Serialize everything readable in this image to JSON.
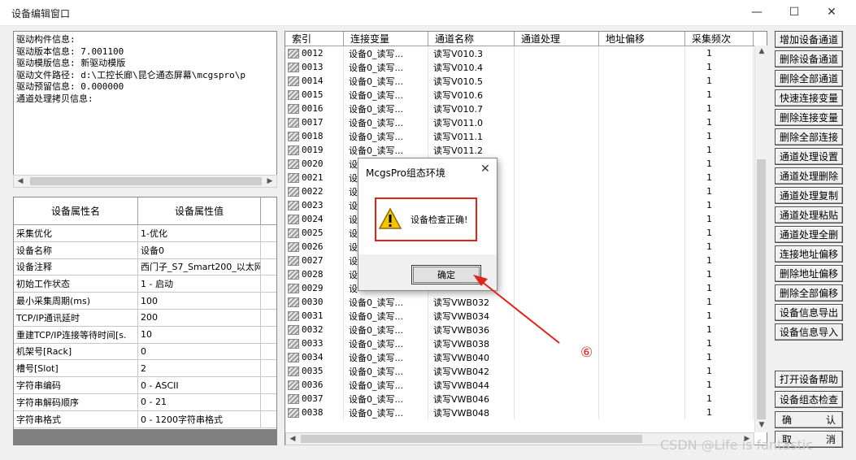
{
  "window": {
    "title": "设备编辑窗口",
    "min_glyph": "—",
    "max_glyph": "☐",
    "close_glyph": "✕"
  },
  "info_lines": [
    "驱动构件信息:",
    "驱动版本信息: 7.001100",
    "驱动模版信息: 新驱动模版",
    "驱动文件路径: d:\\工控长廊\\昆仑通态屏幕\\mcgspro\\p",
    "驱动预留信息: 0.000000",
    "通道处理拷贝信息:"
  ],
  "properties": {
    "header_name": "设备属性名",
    "header_value": "设备属性值",
    "rows": [
      {
        "name": "采集优化",
        "value": "1-优化"
      },
      {
        "name": "设备名称",
        "value": "设备0"
      },
      {
        "name": "设备注释",
        "value": "西门子_S7_Smart200_以太网"
      },
      {
        "name": "初始工作状态",
        "value": "1 - 启动"
      },
      {
        "name": "最小采集周期(ms)",
        "value": "100"
      },
      {
        "name": "TCP/IP通讯延时",
        "value": "200"
      },
      {
        "name": "重建TCP/IP连接等待时间[s.",
        "value": "10"
      },
      {
        "name": "机架号[Rack]",
        "value": "0"
      },
      {
        "name": "槽号[Slot]",
        "value": "2"
      },
      {
        "name": "字符串编码",
        "value": "0 - ASCII"
      },
      {
        "name": "字符串解码顺序",
        "value": "0 - 21"
      },
      {
        "name": "字符串格式",
        "value": "0 - 1200字符串格式"
      }
    ]
  },
  "channels": {
    "headers": [
      "索引",
      "连接变量",
      "通道名称",
      "通道处理",
      "地址偏移",
      "采集频次"
    ],
    "rows": [
      {
        "index": "0012",
        "var": "设备0_读写...",
        "name": "读写V010.3",
        "freq": "1"
      },
      {
        "index": "0013",
        "var": "设备0_读写...",
        "name": "读写V010.4",
        "freq": "1"
      },
      {
        "index": "0014",
        "var": "设备0_读写...",
        "name": "读写V010.5",
        "freq": "1"
      },
      {
        "index": "0015",
        "var": "设备0_读写...",
        "name": "读写V010.6",
        "freq": "1"
      },
      {
        "index": "0016",
        "var": "设备0_读写...",
        "name": "读写V010.7",
        "freq": "1"
      },
      {
        "index": "0017",
        "var": "设备0_读写...",
        "name": "读写V011.0",
        "freq": "1"
      },
      {
        "index": "0018",
        "var": "设备0_读写...",
        "name": "读写V011.1",
        "freq": "1"
      },
      {
        "index": "0019",
        "var": "设备0_读写...",
        "name": "读写V011.2",
        "freq": "1"
      },
      {
        "index": "0020",
        "var": "设",
        "name": "",
        "freq": "1"
      },
      {
        "index": "0021",
        "var": "设",
        "name": "",
        "freq": "1"
      },
      {
        "index": "0022",
        "var": "设",
        "name": "",
        "freq": "1"
      },
      {
        "index": "0023",
        "var": "设",
        "name": "",
        "freq": "1"
      },
      {
        "index": "0024",
        "var": "设",
        "name": "",
        "freq": "1"
      },
      {
        "index": "0025",
        "var": "设",
        "name": "",
        "freq": "1"
      },
      {
        "index": "0026",
        "var": "设",
        "name": "",
        "freq": "1"
      },
      {
        "index": "0027",
        "var": "设",
        "name": "",
        "freq": "1"
      },
      {
        "index": "0028",
        "var": "设",
        "name": "",
        "freq": "1"
      },
      {
        "index": "0029",
        "var": "设",
        "name": "",
        "freq": "1"
      },
      {
        "index": "0030",
        "var": "设备0_读写...",
        "name": "读写VWB032",
        "freq": "1"
      },
      {
        "index": "0031",
        "var": "设备0_读写...",
        "name": "读写VWB034",
        "freq": "1"
      },
      {
        "index": "0032",
        "var": "设备0_读写...",
        "name": "读写VWB036",
        "freq": "1"
      },
      {
        "index": "0033",
        "var": "设备0_读写...",
        "name": "读写VWB038",
        "freq": "1"
      },
      {
        "index": "0034",
        "var": "设备0_读写...",
        "name": "读写VWB040",
        "freq": "1"
      },
      {
        "index": "0035",
        "var": "设备0_读写...",
        "name": "读写VWB042",
        "freq": "1"
      },
      {
        "index": "0036",
        "var": "设备0_读写...",
        "name": "读写VWB044",
        "freq": "1"
      },
      {
        "index": "0037",
        "var": "设备0_读写...",
        "name": "读写VWB046",
        "freq": "1"
      },
      {
        "index": "0038",
        "var": "设备0_读写...",
        "name": "读写VWB048",
        "freq": "1"
      }
    ]
  },
  "buttons": [
    "增加设备通道",
    "删除设备通道",
    "删除全部通道",
    "快速连接变量",
    "删除连接变量",
    "删除全部连接",
    "通道处理设置",
    "通道处理删除",
    "通道处理复制",
    "通道处理粘贴",
    "通道处理全删",
    "连接地址偏移",
    "删除地址偏移",
    "删除全部偏移",
    "设备信息导出",
    "设备信息导入"
  ],
  "buttons_bottom": [
    "打开设备帮助",
    "设备组态检查"
  ],
  "ok_button": {
    "left": "确",
    "right": "认"
  },
  "cancel_button": {
    "left": "取",
    "right": "消"
  },
  "dialog": {
    "title": "McgsPro组态环境",
    "close_glyph": "✕",
    "message": "设备检查正确!",
    "ok_label": "确定"
  },
  "annotation": {
    "step": "⑥",
    "color": "#e2231a"
  },
  "watermark": "CSDN @Life is fantastic",
  "colors": {
    "highlight": "#e2231a",
    "gray_panel": "#808080"
  }
}
